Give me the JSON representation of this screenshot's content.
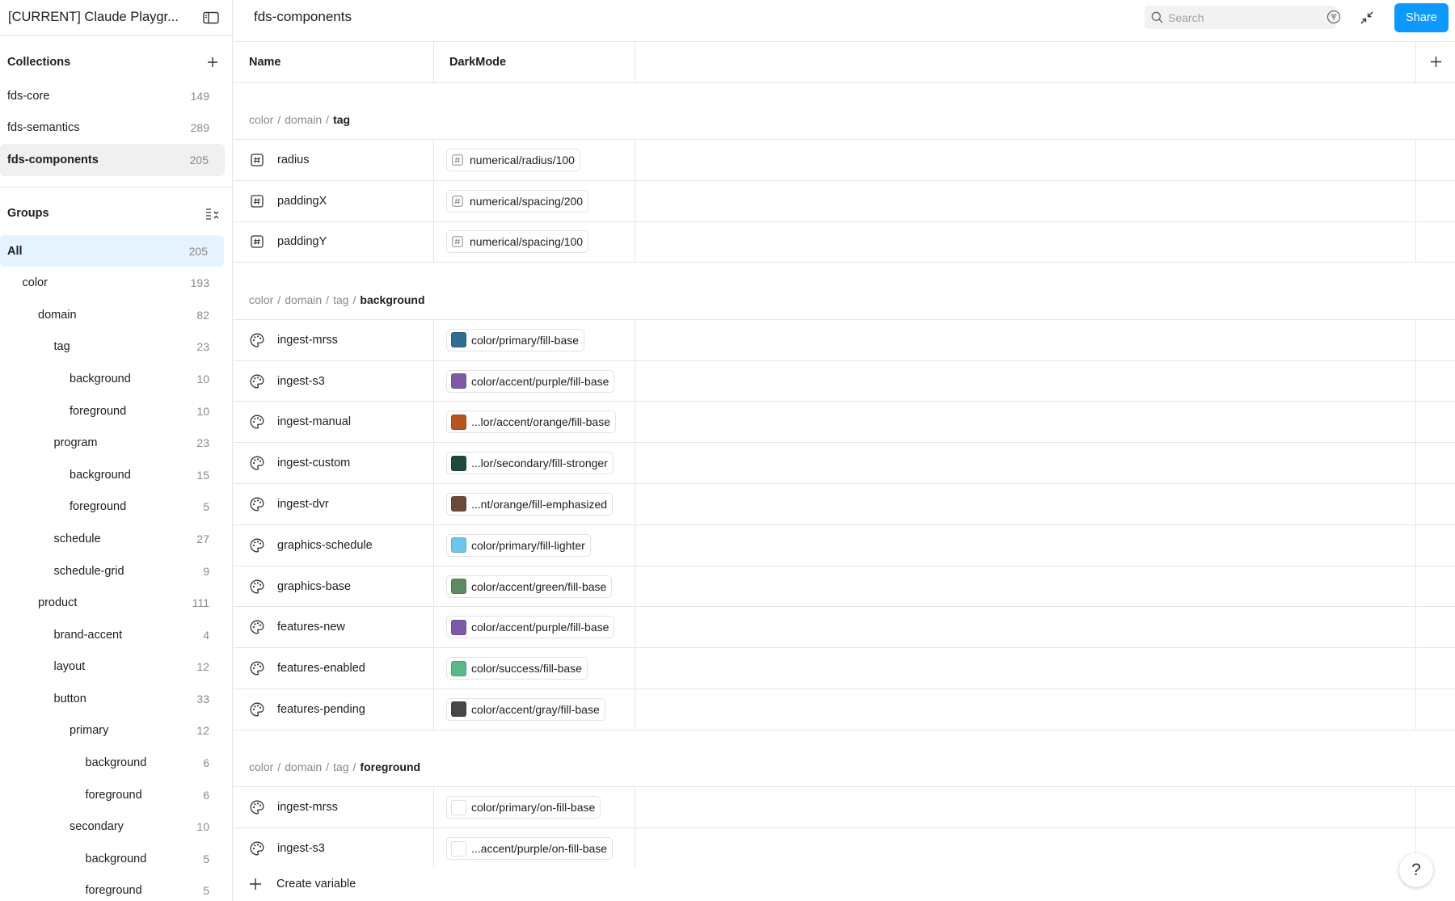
{
  "sidebar": {
    "file_title": "[CURRENT] Claude Playgr...",
    "collections_label": "Collections",
    "collections": [
      {
        "label": "fds-core",
        "count": "149"
      },
      {
        "label": "fds-semantics",
        "count": "289"
      },
      {
        "label": "fds-components",
        "count": "205"
      }
    ],
    "groups_label": "Groups",
    "groups": [
      {
        "label": "All",
        "count": "205",
        "level": 0
      },
      {
        "label": "color",
        "count": "193",
        "level": 1
      },
      {
        "label": "domain",
        "count": "82",
        "level": 2
      },
      {
        "label": "tag",
        "count": "23",
        "level": 3
      },
      {
        "label": "background",
        "count": "10",
        "level": 4
      },
      {
        "label": "foreground",
        "count": "10",
        "level": 4
      },
      {
        "label": "program",
        "count": "23",
        "level": 3
      },
      {
        "label": "background",
        "count": "15",
        "level": 4
      },
      {
        "label": "foreground",
        "count": "5",
        "level": 4
      },
      {
        "label": "schedule",
        "count": "27",
        "level": 3
      },
      {
        "label": "schedule-grid",
        "count": "9",
        "level": 3
      },
      {
        "label": "product",
        "count": "111",
        "level": 2
      },
      {
        "label": "brand-accent",
        "count": "4",
        "level": 3
      },
      {
        "label": "layout",
        "count": "12",
        "level": 3
      },
      {
        "label": "button",
        "count": "33",
        "level": 3
      },
      {
        "label": "primary",
        "count": "12",
        "level": 4
      },
      {
        "label": "background",
        "count": "6",
        "level": 5
      },
      {
        "label": "foreground",
        "count": "6",
        "level": 5
      },
      {
        "label": "secondary",
        "count": "10",
        "level": 4
      },
      {
        "label": "background",
        "count": "5",
        "level": 5
      },
      {
        "label": "foreground",
        "count": "5",
        "level": 5
      }
    ]
  },
  "topbar": {
    "title": "fds-components",
    "search_placeholder": "Search",
    "share_label": "Share"
  },
  "table": {
    "col_name": "Name",
    "col_mode": "DarkMode",
    "groups": [
      {
        "path": [
          "color",
          "domain",
          "tag"
        ],
        "rows": [
          {
            "name": "radius",
            "type": "number",
            "value": "numerical/radius/100"
          },
          {
            "name": "paddingX",
            "type": "number",
            "value": "numerical/spacing/200"
          },
          {
            "name": "paddingY",
            "type": "number",
            "value": "numerical/spacing/100"
          }
        ]
      },
      {
        "path": [
          "color",
          "domain",
          "tag",
          "background"
        ],
        "rows": [
          {
            "name": "ingest-mrss",
            "type": "color",
            "value": "color/primary/fill-base",
            "swatch": "#2f6e8f"
          },
          {
            "name": "ingest-s3",
            "type": "color",
            "value": "color/accent/purple/fill-base",
            "swatch": "#7d5aa6"
          },
          {
            "name": "ingest-manual",
            "type": "color",
            "value": "...lor/accent/orange/fill-base",
            "swatch": "#b8531f"
          },
          {
            "name": "ingest-custom",
            "type": "color",
            "value": "...lor/secondary/fill-stronger",
            "swatch": "#1d4a3c"
          },
          {
            "name": "ingest-dvr",
            "type": "color",
            "value": "...nt/orange/fill-emphasized",
            "swatch": "#6b4a3a"
          },
          {
            "name": "graphics-schedule",
            "type": "color",
            "value": "color/primary/fill-lighter",
            "swatch": "#6cc5ea"
          },
          {
            "name": "graphics-base",
            "type": "color",
            "value": "color/accent/green/fill-base",
            "swatch": "#5e8a63"
          },
          {
            "name": "features-new",
            "type": "color",
            "value": "color/accent/purple/fill-base",
            "swatch": "#7d5aa6"
          },
          {
            "name": "features-enabled",
            "type": "color",
            "value": "color/success/fill-base",
            "swatch": "#58b889"
          },
          {
            "name": "features-pending",
            "type": "color",
            "value": "color/accent/gray/fill-base",
            "swatch": "#474747"
          }
        ]
      },
      {
        "path": [
          "color",
          "domain",
          "tag",
          "foreground"
        ],
        "rows": [
          {
            "name": "ingest-mrss",
            "type": "color",
            "value": "color/primary/on-fill-base",
            "swatch": "#ffffff"
          },
          {
            "name": "ingest-s3",
            "type": "color",
            "value": "...accent/purple/on-fill-base",
            "swatch": "#ffffff"
          }
        ]
      }
    ],
    "create_label": "Create variable"
  },
  "help_label": "?",
  "colors": {
    "accent": "#0d99ff",
    "active_group_bg": "#e5f3ff",
    "border": "#e6e6e6",
    "muted_text": "#8a8a8a"
  }
}
